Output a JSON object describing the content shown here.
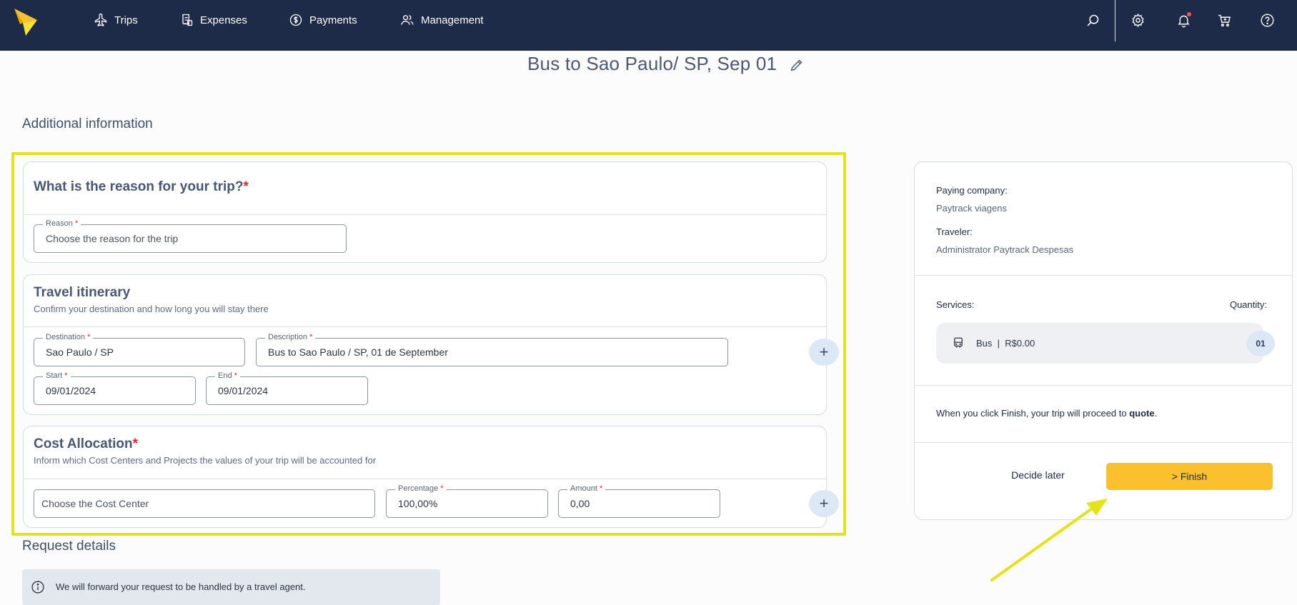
{
  "nav": {
    "items": [
      {
        "label": "Trips",
        "icon": "plane-icon"
      },
      {
        "label": "Expenses",
        "icon": "receipt-icon"
      },
      {
        "label": "Payments",
        "icon": "dollar-circle-icon"
      },
      {
        "label": "Management",
        "icon": "users-icon"
      }
    ],
    "right_icons": [
      "search-icon",
      "gear-icon",
      "bell-icon",
      "cart-icon",
      "help-icon"
    ]
  },
  "trip": {
    "title": "Bus to Sao Paulo/ SP, Sep 01"
  },
  "additional_info": {
    "title": "Additional information",
    "reason_card": {
      "title": "What is the reason for your trip?",
      "required_mark": "*",
      "reason_field": {
        "label": "Reason",
        "required_mark": "*",
        "placeholder": "Choose the reason for the trip"
      }
    },
    "itinerary_card": {
      "title": "Travel itinerary",
      "subtitle": "Confirm your destination and how long you will stay there",
      "destination": {
        "label": "Destination",
        "required_mark": "*",
        "value": "Sao Paulo / SP"
      },
      "description": {
        "label": "Description",
        "required_mark": "*",
        "value": "Bus to Sao Paulo / SP, 01 de September"
      },
      "start": {
        "label": "Start",
        "required_mark": "*",
        "value": "09/01/2024"
      },
      "end": {
        "label": "End",
        "required_mark": "*",
        "value": "09/01/2024"
      },
      "add_symbol": "+"
    },
    "cost_card": {
      "title": "Cost Allocation",
      "required_mark": "*",
      "subtitle": "Inform which Cost Centers and Projects the values of your trip will be accounted for",
      "cost_center": {
        "placeholder": "Choose the Cost Center"
      },
      "percentage": {
        "label": "Percentage",
        "required_mark": "*",
        "value": "100,00%"
      },
      "amount": {
        "label": "Amount",
        "required_mark": "*",
        "value": "0,00"
      },
      "add_symbol": "+"
    }
  },
  "request_details": {
    "title": "Request details",
    "info_text": "We will forward your request to be handled by a travel agent."
  },
  "summary": {
    "paying_company_label": "Paying company:",
    "paying_company": "Paytrack viagens",
    "traveler_label": "Traveler:",
    "traveler": "Administrator Paytrack Despesas",
    "services_label": "Services:",
    "quantity_label": "Quantity:",
    "service": {
      "name": "Bus",
      "separator": "|",
      "price": "R$0.00",
      "quantity": "01"
    },
    "note_prefix": "When you click Finish, your trip will proceed to ",
    "note_bold": "quote",
    "note_suffix": ".",
    "decide_later": "Decide later",
    "finish": "> Finish"
  },
  "colors": {
    "topbar": "#1d2a48",
    "highlight": "#e3e31b",
    "finish_button": "#fbc02d",
    "required": "#e5262e",
    "arrow": "#e3e31b"
  }
}
